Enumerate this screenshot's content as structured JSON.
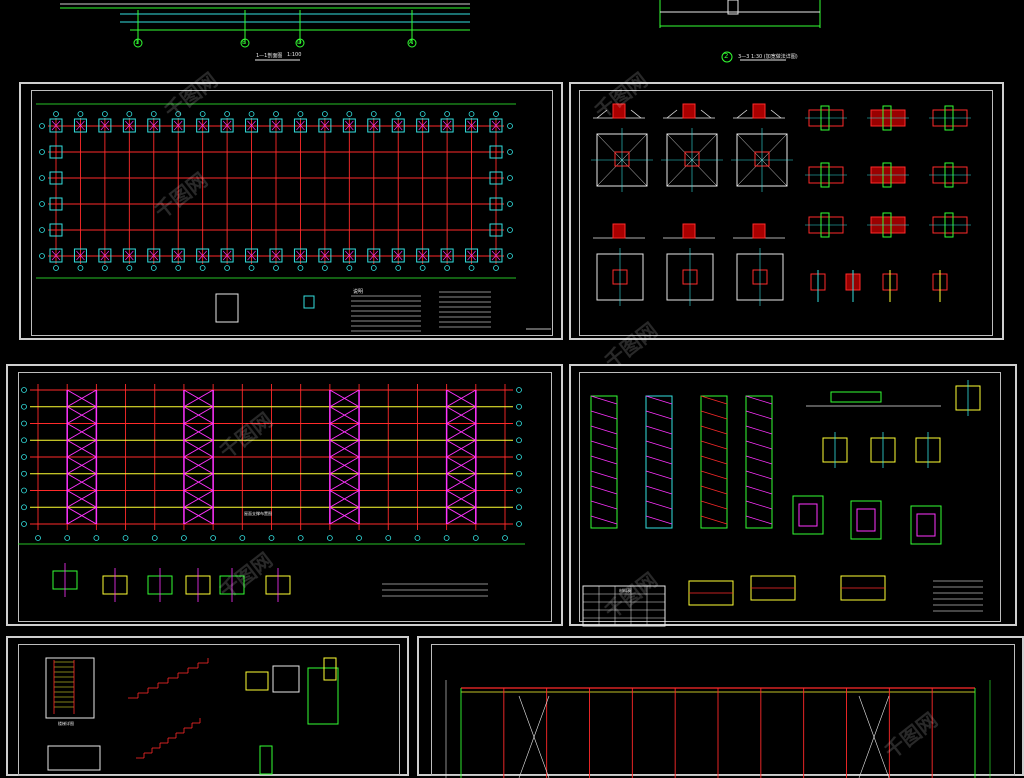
{
  "top_strip": {
    "title_left": "1—1剖面图",
    "scale_left": "1:100",
    "axis_labels": [
      "1",
      "B",
      "D",
      "A"
    ],
    "section_num": "2",
    "section_title": "3—3 1:30 (加宽做法详图)"
  },
  "sheets": {
    "foundation_plan": {
      "note_title": "说明"
    },
    "foundation_details": {},
    "roof_bracing": {
      "plan_title": "屋面支撑布置图"
    },
    "column_details": {
      "table_title": "材料表"
    },
    "stair_details": {
      "stair_title": "楼梯详图"
    },
    "elevation": {}
  },
  "watermark": "千图网",
  "colors": {
    "grid_red": "#ff2a2a",
    "axis_cyan": "#33e0e0",
    "brace_magenta": "#ff33ff",
    "purlin_yellow": "#ffff33",
    "dim_green": "#33ff33",
    "text_white": "#e8e8e8"
  }
}
